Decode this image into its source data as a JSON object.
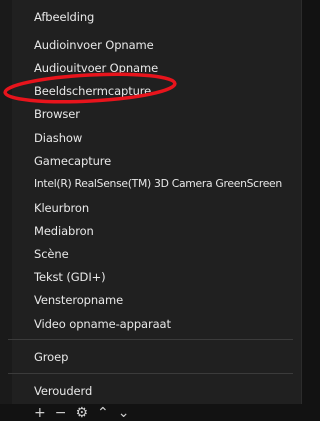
{
  "menu": {
    "items": [
      {
        "label": "Afbeelding"
      },
      {
        "label": "Audioinvoer Opname"
      },
      {
        "label": "Audiouitvoer Opname"
      },
      {
        "label": "Beeldschermcapture"
      },
      {
        "label": "Browser"
      },
      {
        "label": "Diashow"
      },
      {
        "label": "Gamecapture"
      },
      {
        "label": "Intel(R) RealSense(TM) 3D Camera GreenScreen"
      },
      {
        "label": "Kleurbron"
      },
      {
        "label": "Mediabron"
      },
      {
        "label": "Scène"
      },
      {
        "label": "Tekst (GDI+)"
      },
      {
        "label": "Vensteropname"
      },
      {
        "label": "Video opname-apparaat"
      }
    ],
    "group_label": "Groep",
    "deprecated_label": "Verouderd"
  },
  "annotation": {
    "color": "#e8141c"
  },
  "toolbar": {
    "icons": [
      "plus-icon",
      "minus-icon",
      "gear-icon",
      "up-arrow-icon",
      "down-arrow-icon"
    ]
  }
}
